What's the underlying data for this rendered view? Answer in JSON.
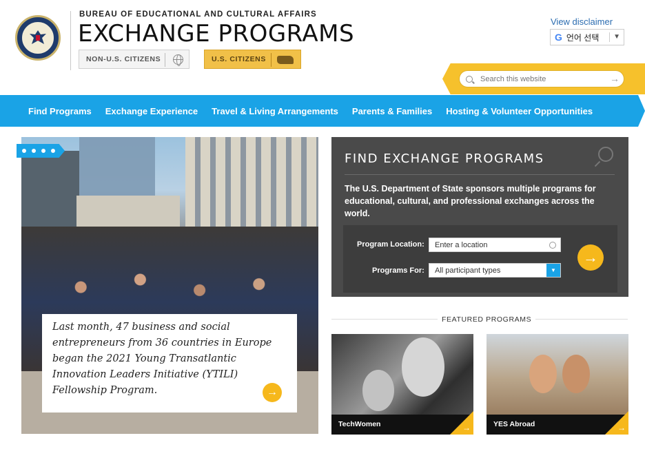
{
  "header": {
    "bureau": "BUREAU OF EDUCATIONAL AND CULTURAL AFFAIRS",
    "title": "EXCHANGE PROGRAMS",
    "non_us_label": "NON-U.S. CITIZENS",
    "us_label": "U.S. CITIZENS",
    "disclaimer": "View disclaimer",
    "translate_label": "언어 선택",
    "translate_g": "G"
  },
  "search": {
    "placeholder": "Search this website"
  },
  "nav": {
    "items": [
      {
        "label": "Find Programs"
      },
      {
        "label": "Exchange Experience"
      },
      {
        "label": "Travel & Living Arrangements"
      },
      {
        "label": "Parents & Families"
      },
      {
        "label": "Hosting & Volunteer Opportunities"
      }
    ]
  },
  "hero": {
    "caption": "Last month, 47 business and social entrepreneurs from 36 countries in Europe began the 2021 Young Transatlantic Innovation Leaders Initiative (YTILI) Fellowship Program."
  },
  "find": {
    "title": "FIND EXCHANGE PROGRAMS",
    "description": "The U.S. Department of State sponsors multiple programs for educational, cultural, and professional exchanges across the world.",
    "location_label": "Program Location:",
    "location_placeholder": "Enter a location",
    "programs_for_label": "Programs For:",
    "programs_for_value": "All participant types"
  },
  "featured": {
    "heading": "FEATURED PROGRAMS",
    "cards": [
      {
        "label": "TechWomen"
      },
      {
        "label": "YES Abroad"
      }
    ]
  },
  "colors": {
    "accent_blue": "#1aa3e6",
    "accent_yellow": "#f6b81c",
    "panel_gray": "#4a4a4a"
  }
}
